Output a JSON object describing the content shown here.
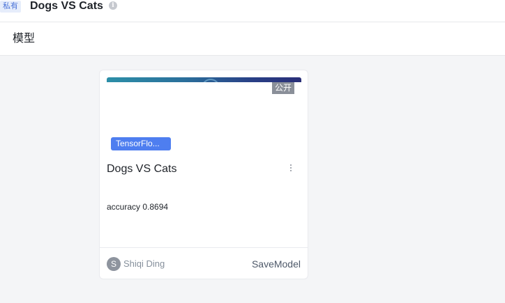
{
  "header": {
    "private_badge": "私有",
    "project_title": "Dogs VS Cats",
    "info_icon": "info-icon"
  },
  "section": {
    "title": "模型"
  },
  "model_card": {
    "visibility_badge": "公开",
    "framework_tag": "TensorFlo...",
    "name": "Dogs VS Cats",
    "metric": "accuracy 0.8694",
    "author_initial": "S",
    "author": "Shiqi Ding",
    "format": "SaveModel",
    "banner_colors": [
      "#2c8fa8",
      "#293f86",
      "#2a2f78"
    ]
  },
  "colors": {
    "accent": "#4e7ef0",
    "page_background": "#f4f5f7"
  }
}
